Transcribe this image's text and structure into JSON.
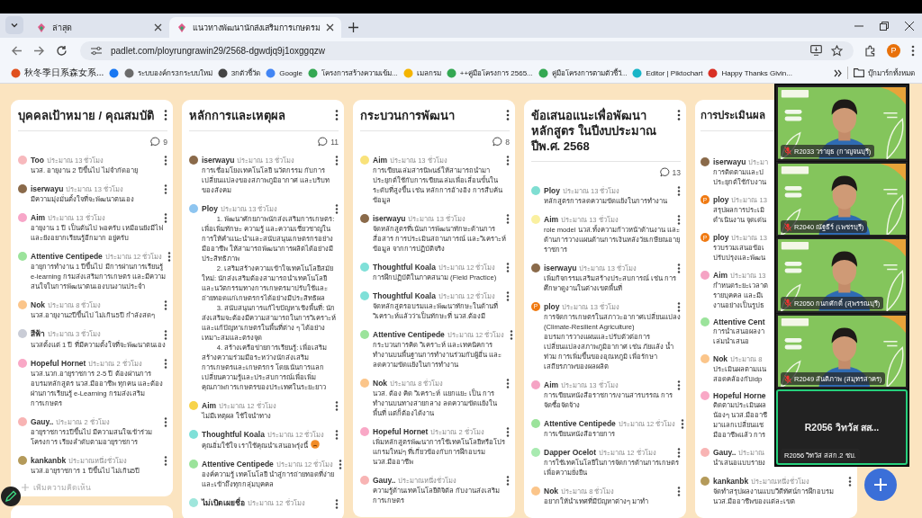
{
  "browser": {
    "tabs": [
      {
        "title": "ล่าสุด",
        "selected": false
      },
      {
        "title": "แนวทางพัฒนานักส่งเสริมการเกษตรม",
        "selected": true
      }
    ],
    "url": "padlet.com/ployrungrawin29/2568-dgwdjq9j1oxggqzw",
    "profile_initial": "P",
    "bookmarks": [
      {
        "label": "秋冬季日系森女系...",
        "color": "#e0501e"
      },
      {
        "color": "#1877f2"
      },
      {
        "label": "ระบบองค์กร3กระบบใหม่",
        "color": "#6b6b6b"
      },
      {
        "label": "3กตัวชี้วัด",
        "color": "#444444"
      },
      {
        "label": "Google",
        "color": "#4285f4"
      },
      {
        "label": "โครงการสร้างความเข้ม...",
        "color": "#34a853"
      },
      {
        "label": "เมลกรม",
        "color": "#f4b400"
      },
      {
        "label": "++คู่มือโครงการ 2565...",
        "color": "#34a853"
      },
      {
        "label": "คู่มือโครงการตามตัวชี้วั...",
        "color": "#34a853"
      },
      {
        "label": "Editor | Piktochart",
        "color": "#19b5c8"
      },
      {
        "label": "Happy Thanks Givin...",
        "color": "#d93025"
      }
    ],
    "all_bookmarks": "บุ๊กมาร์กทั้งหมด"
  },
  "board": {
    "columns": [
      {
        "title": "บุคคลเป้าหมาย / คุณสมบัติ",
        "comments": "9",
        "comment_field": {
          "placeholder": "เพิ่มความคิดเห็น"
        },
        "posts": [
          {
            "author": "Too",
            "time": "ประมาณ 13 ชั่วโมง",
            "color": "#f7b9bd",
            "body": [
              "นวส. อายุงาน 2 ปีขึ้นไป ไม่จำกัดอายุ"
            ]
          },
          {
            "author": "iserwayu",
            "time": "ประมาณ 13 ชั่วโมง",
            "color": "#8a6a4a",
            "body": [
              "มีความมุ่งมั่นตั้งใจที่จะพัฒนาตนเอง"
            ]
          },
          {
            "author": "Aim",
            "time": "ประมาณ 13 ชั่วโมง",
            "color": "#f7a6c8",
            "body": [
              "อายุงาน 1 ปี เป็นต้นไป พอครับ เหมือนยังมีไฟ และยังอยากเรียนรู้อีกมาก อยู่ครับ"
            ]
          },
          {
            "author": "Attentive Centipede",
            "time": "ประมาณ 12 ชั่วโมง",
            "color": "#9be39b",
            "body": [
              "อายุการทำงาน 1 ปีขึ้นไป มีการผ่านการเรียนรู้ e-learning กรมส่งเสริมการเกษตร และมีความสนใจในการพัฒนาตนเองบนงานประจำ"
            ]
          },
          {
            "author": "Nok",
            "time": "ประมาณ 8 ชั่วโมง",
            "color": "#fbc58a",
            "body": [
              "นวส.อายุงาน2ปีขึ้นไป ไม่เกิน5ปี กำลังสดๆ"
            ]
          },
          {
            "author": "สีฟ้า",
            "time": "ประมาณ 3 ชั่วโมง",
            "color": "#c9ccd6",
            "body": [
              "นวสตั้งแต่ 1 ปี ที่มีความตั้งใจที่จะพัฒนาตนเอง"
            ]
          },
          {
            "author": "Hopeful Hornet",
            "time": "ประมาณ 2 ชั่วโมง",
            "color": "#f9a8c6",
            "body": [
              "นวส.นวก.อายุราชการ 2-5 ปี ต้องผ่านการอบรมหลักสูตร นวส.มืออาชีพ ทุกคน และต้องผ่านการเรียนรู้ e-Learning กรมส่งเสริมการเกษตร"
            ]
          },
          {
            "author": "Gauy..",
            "time": "ประมาณ 2 ชั่วโมง",
            "color": "#f8b4b4",
            "body": [
              "อายุราชการ1ปีขึ้นไป มีความสนใจเข้าร่วมโครงการ เรียงลำดับตามอายุราชการ"
            ]
          },
          {
            "author": "kankanbk",
            "time": "ประมาณหนึ่งชั่วโมง",
            "color": "#b49a5a",
            "body": [
              "นวส.อายุราชการ 1 ปีขึ้นไป ไม่เกิน5ปี"
            ]
          }
        ]
      },
      {
        "title": "หลักการและเหตุผล",
        "comments": "11",
        "posts": [
          {
            "author": "iserwayu",
            "time": "ประมาณ 13 ชั่วโมง",
            "color": "#8a6a4a",
            "body": [
              "การเชื่อมโยงเทคโนโลยี นวัตกรรม กับการเปลี่ยนแปลงของสภาพภูมิอากาศ และบริบทของสังคม"
            ]
          },
          {
            "author": "Ploy",
            "time": "ประมาณ 13 ชั่วโมง",
            "color": "#8ec5f0",
            "indented": true,
            "body": [
              "1. พัฒนาศักยภาพนักส่งเสริมการเกษตร: เพื่อเพิ่มทักษะ ความรู้ และความเชี่ยวชาญในการให้คำแนะนำและสนับสนุนเกษตรกรอย่างมืออาชีพ ให้สามารถพัฒนาการผลิตได้อย่างมีประสิทธิภาพ",
              "2. เสริมสร้างความเข้าใจเทคโนโลยีสมัยใหม่: นักส่งเสริมต้องสามารถนำเทคโนโลยีและนวัตกรรมทางการเกษตรมาปรับใช้และถ่ายทอดแก่เกษตรกรได้อย่างมีประสิทธิผล",
              "3. สนับสนุนการแก้ไขปัญหาเชิงพื้นที่: นักส่งเสริมจะต้องมีความสามารถในการวิเคราะห์และแก้ปัญหาเกษตรในพื้นที่ต่าง ๆ ได้อย่างเหมาะสมและตรงจุด",
              "4. สร้างเครือข่ายการเรียนรู้: เพื่อเสริมสร้างความร่วมมือระหว่างนักส่งเสริมการเกษตรและเกษตรกร โดยเน้นการแลกเปลี่ยนความรู้และประสบการณ์เพื่อเพิ่มคุณภาพการเกษตรของประเทศในระยะยาว"
            ]
          },
          {
            "author": "Aim",
            "time": "ประมาณ 12 ชั่วโมง",
            "color": "#f7d34a",
            "body": [
              "ไม่มีเหตุผล ใช้ใจนำทาง"
            ]
          },
          {
            "author": "Thoughtful Koala",
            "time": "ประมาณ 12 ชั่วโมง",
            "color": "#7fe0d8",
            "emoji": true,
            "body": [
              "คุณอิ่มใช้ใจ เราใช้คุณนำเสนอพรุ่งนี้"
            ]
          },
          {
            "author": "Attentive Centipede",
            "time": "ประมาณ 12 ชั่วโมง",
            "color": "#9be39b",
            "body": [
              "องค์ความรู้ เทคโนโลยี นำสู่การถ่ายทอดที่ง่ายและเข้าถึงทุกกลุ่มบุคคล"
            ]
          },
          {
            "author": "ไม่เปิดเผยชื่อ",
            "time": "ประมาณ 12 ชั่วโมง",
            "color": "#9fe6dc"
          }
        ]
      },
      {
        "title": "กระบวนการพัฒนา",
        "comments": "8",
        "posts": [
          {
            "author": "Aim",
            "time": "ประมาณ 13 ชั่วโมง",
            "color": "#f9e27a",
            "body": [
              "การเขียนเล่มสารนิพนธ์ให้สามารถนำมาประยุกต์ใช้กับการเขียนเล่มเพื่อเลื่อนขั้นในระดับที่สูงขึ้น เช่น หลักการอ้างอิง การสืบค้นข้อมูล"
            ]
          },
          {
            "author": "iserwayu",
            "time": "ประมาณ 13 ชั่วโมง",
            "color": "#8a6a4a",
            "body": [
              "จัดหลักสูตรที่เน้นการพัฒนาทักษะด้านการสื่อสาร การประเมินสถานการณ์ และวิเคราะห์ข้อมูล จากการปฏิบัติจริง"
            ]
          },
          {
            "author": "Thoughtful Koala",
            "time": "ประมาณ 12 ชั่วโมง",
            "color": "#7fe0d8",
            "body": [
              "การฝึกปฏิบัติในภาคสนาม (Field Practice)"
            ]
          },
          {
            "author": "Thoughtful Koala",
            "time": "ประมาณ 12 ชั่วโมง",
            "color": "#7fe0d8",
            "body": [
              "จัดหลักสูตรอบรมและพัฒนาทักษะในด้านที่วิเคราะห์แล้วว่าเป็นทักษะที่ นวส.ต้องมี"
            ]
          },
          {
            "author": "Attentive Centipede",
            "time": "ประมาณ 12 ชั่วโมง",
            "color": "#9be39b",
            "body": [
              "กระบวนการคิด วิเคราะห์ และเทคนิคการทำงานบนพื้นฐานการทำงานร่วมกับผู้อื่น และลดความขัดแย้งในการทำงาน"
            ]
          },
          {
            "author": "Nok",
            "time": "ประมาณ 8 ชั่วโมง",
            "color": "#fbc58a",
            "body": [
              "นวส. ต้อง คิด วิเคราะห์ แยกแยะ เป็น การทำงานบนทางสายกลาง ลดความขัดแย้งในพื้นที่ แต่ก็ต้องได้งาน"
            ]
          },
          {
            "author": "Hopeful Hornet",
            "time": "ประมาณ 2 ชั่วโมง",
            "color": "#f9a8c6",
            "body": [
              "เพิ่มหลักสูตรพัฒนาการใช้เทคโนโลยีหรือโปรแกรมใหม่ๆ ที่เกี่ยวข้องกับการฝึกอบรม นวส.มืออาชีพ"
            ]
          },
          {
            "author": "Gauy..",
            "time": "ประมาณหนึ่งชั่วโมง",
            "color": "#f8b4b4",
            "body": [
              "ความรู้ด้านเทคโนโลยีดิจิตัล กับงานส่งเสริมการเกษตร"
            ]
          }
        ]
      },
      {
        "title": "ข้อเสนอแนะเพื่อพัฒนาหลักสูตร ในปีงบประมาณปีพ.ศ. 2568",
        "comments": "13",
        "posts": [
          {
            "author": "Ploy",
            "time": "ประมาณ 13 ชั่วโมง",
            "color": "#7fded2",
            "body": [
              "หลักสูตรการลดความขัดแย้งในการทำงาน"
            ]
          },
          {
            "author": "Aim",
            "time": "ประมาณ 13 ชั่วโมง",
            "color": "#faf0a0",
            "body": [
              "role model นวส.ทั้งความก้าวหน้าด้านงาน และด้านการวางแผนด้านการเงินหลังวัยเกษียณอายุราชการ"
            ]
          },
          {
            "author": "iserwayu",
            "time": "ประมาณ 13 ชั่วโมง",
            "color": "#8a6a4a",
            "body": [
              "เพิ่มกิจกรรมเสริมสร้างประสบการณ์ เช่น การศึกษาดูงานในต่างเขตพื้นที่"
            ]
          },
          {
            "author": "ploy",
            "time": "ประมาณ 13 ชั่วโมง",
            "color": "#f07a12",
            "initial": "P",
            "body": [
              "การจัดการเกษตรในสภาวะอากาศเปลี่ยนแปลง (Climate-Resilient Agriculture)",
              "อบรมการวางแผนและปรับตัวต่อการเปลี่ยนแปลงสภาพภูมิอากาศ เช่น ภัยแล้ง น้ำท่วม การเพิ่มขึ้นของอุณหภูมิ เพื่อรักษาเสถียรภาพของผลผลิต"
            ]
          },
          {
            "author": "Aim",
            "time": "ประมาณ 13 ชั่วโมง",
            "color": "#f5a3c4",
            "body": [
              "การเขียนหนังสือราชการ/งานสารบรรณ การจัดซื้อจัดจ้าง"
            ]
          },
          {
            "author": "Attentive Centipede",
            "time": "ประมาณ 12 ชั่วโมง",
            "color": "#9be39b",
            "body": [
              "การเขียนหนังสือรายการ"
            ]
          },
          {
            "author": "Dapper Ocelot",
            "time": "ประมาณ 12 ชั่วโมง",
            "color": "#a8eab0",
            "body": [
              "การใช้เทคโนโลยีในการจัดการด้านการเกษตรเพื่อความยั่งยืน"
            ]
          },
          {
            "author": "Nok",
            "time": "ประมาณ 8 ชั่วโมง",
            "color": "#fbc58a",
            "body": [
              "อยากให้นำเทศที่มีปัญหาต่างๆ มาทำ"
            ]
          }
        ]
      },
      {
        "title": "การประเมินผล",
        "clipped": true,
        "posts": [
          {
            "author": "iserwayu",
            "time": "ประมา",
            "color": "#8a6a4a",
            "menu": false,
            "body": [
              "การติดตามและป",
              "ประยุกต์ใช้กับงาน"
            ]
          },
          {
            "author": "ploy",
            "time": "ประมาณ 13",
            "color": "#f07a12",
            "initial": "P",
            "menu": false,
            "body": [
              "สรุปผลการประเมิ",
              "ดำเนินงาน จุดเด่น"
            ]
          },
          {
            "author": "ploy",
            "time": "ประมาณ 13",
            "color": "#f07a12",
            "initial": "P",
            "menu": false,
            "body": [
              "รวบรวมเสนอข้อเ",
              "ปรับปรุงและพัฒน"
            ]
          },
          {
            "author": "Aim",
            "time": "ประมาณ 13",
            "color": "#f5a3c4",
            "menu": false,
            "body": [
              "กำหนดระยะเวลาต",
              "รายบุคคล และมีเ",
              "งานอย่างเป็นรูปธ"
            ]
          },
          {
            "author": "Attentive Cent",
            "color": "#9be39b",
            "menu": false,
            "body": [
              "การนำเสนอผลงา",
              "เล่มนำเสนอ"
            ]
          },
          {
            "author": "Nok",
            "time": "ประมาณ 8",
            "color": "#fbc58a",
            "menu": false,
            "body": [
              "ประเมินผลตามแน",
              "สอดคล้องกับidp"
            ]
          },
          {
            "author": "Hopeful Horne",
            "color": "#f9a8c6",
            "menu": false,
            "body": [
              "ติดตามประเมินผล",
              "น้องๆ นวส.มืออาชี",
              "มาแลกเปลี่ยนแช",
              "มืออาชีพแล้ว การ"
            ]
          },
          {
            "author": "Gauy..",
            "time": "ประมาณ",
            "color": "#f8b4b4",
            "menu": false,
            "body": [
              "นำเสนอแบบรายง"
            ]
          },
          {
            "author": "kankanbk",
            "time": "ประมาณหนึ่งชั่วโมง",
            "color": "#b49a5a",
            "menu": true,
            "body": [
              "จัดทำสรุปผลงานแบบวีดีทัศน์การฝึกอบรม",
              "นวส.มืออาชีพของแต่ละเขต"
            ]
          }
        ]
      }
    ]
  },
  "meeting": {
    "tiles": [
      {
        "name": "R2033 วรายุธ (กาญจนบุรี)",
        "camera": true,
        "muted": true,
        "speaking": false
      },
      {
        "name": "R2040 ณัฐธีร์ (เพชรบุรี)",
        "camera": true,
        "muted": true,
        "speaking": false
      },
      {
        "name": "R2050 กนกศักดิ์ (สุพรรณบุรี)",
        "camera": true,
        "muted": true,
        "speaking": false
      },
      {
        "name": "R2049 สันติภาพ (สมุทรสาคร)",
        "camera": true,
        "muted": true,
        "speaking": false
      },
      {
        "name": "R2056 วิทวัส สสก.2 ชบ.",
        "display_name": "R2056 วิทวัส สส...",
        "camera": false,
        "muted": false,
        "speaking": true
      }
    ]
  }
}
